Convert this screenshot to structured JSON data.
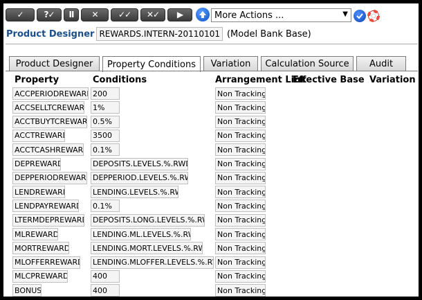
{
  "toolbar": {
    "buttons": [
      {
        "name": "commit-button",
        "label": "✓",
        "w": 42
      },
      {
        "name": "validate-button",
        "label": "?✓",
        "w": 36
      },
      {
        "name": "hold-button",
        "label": "II",
        "w": 22
      },
      {
        "name": "delete-button",
        "label": "✕",
        "w": 40
      },
      {
        "name": "authorise-button",
        "label": "✓✓",
        "w": 40
      },
      {
        "name": "reverse-button",
        "label": "✕✓",
        "w": 36
      },
      {
        "name": "next-button",
        "label": "▶",
        "w": 36
      }
    ],
    "action_select": "More Actions ..."
  },
  "header": {
    "title": "Product Designer",
    "record_id": "REWARDS.INTERN-20110101",
    "record_desc": "(Model Bank Base)"
  },
  "tabs": [
    {
      "label": "Product Designer",
      "active": false
    },
    {
      "label": "Property Conditions",
      "active": true
    },
    {
      "label": "Variation",
      "active": false
    },
    {
      "label": "Calculation Source",
      "active": false
    },
    {
      "label": "Audit",
      "active": false
    }
  ],
  "columns": {
    "property": "Property",
    "conditions": "Conditions",
    "arrangement": "Arrangement Link",
    "effective_base": "Effective Base",
    "variation": "Variation"
  },
  "rows": [
    {
      "property": "ACCPERIODREWARD",
      "condition": "200",
      "arrangement": "Non Tracking"
    },
    {
      "property": "ACCSELLTCREWARD",
      "condition": "1%",
      "arrangement": "Non Tracking"
    },
    {
      "property": "ACCTBUYTCREWARD",
      "condition": "0.5%",
      "arrangement": "Non Tracking"
    },
    {
      "property": "ACCTREWARD",
      "condition": "3500",
      "arrangement": "Non Tracking"
    },
    {
      "property": "ACCTCASHREWARD",
      "condition": "0.1%",
      "arrangement": "Non Tracking"
    },
    {
      "property": "DEPREWARD",
      "condition": "DEPOSITS.LEVELS.%.RWD",
      "arrangement": "Non Tracking"
    },
    {
      "property": "DEPPERIODREWARD",
      "condition": "DEPPERIOD.LEVELS.%.RWD",
      "arrangement": "Non Tracking"
    },
    {
      "property": "LENDREWARD",
      "condition": "LENDING.LEVELS.%.RWD",
      "arrangement": "Non Tracking"
    },
    {
      "property": "LENDPAYREWARD",
      "condition": "0.1%",
      "arrangement": "Non Tracking"
    },
    {
      "property": "LTERMDEPREWARD",
      "condition": "DEPOSITS.LONG.LEVELS.%.RWD",
      "arrangement": "Non Tracking"
    },
    {
      "property": "MLREWARD",
      "condition": "LENDING.ML.LEVELS.%.RWD",
      "arrangement": "Non Tracking"
    },
    {
      "property": "MORTREWARD",
      "condition": "LENDING.MORT.LEVELS.%.RWD",
      "arrangement": "Non Tracking"
    },
    {
      "property": "MLOFFERREWARD",
      "condition": "LENDING.MLOFFER.LEVELS.%.RWD",
      "arrangement": "Non Tracking"
    },
    {
      "property": "MLCPREWARD",
      "condition": "400",
      "arrangement": "Non Tracking"
    },
    {
      "property": "BONUS",
      "condition": "400",
      "arrangement": "Non Tracking"
    }
  ]
}
